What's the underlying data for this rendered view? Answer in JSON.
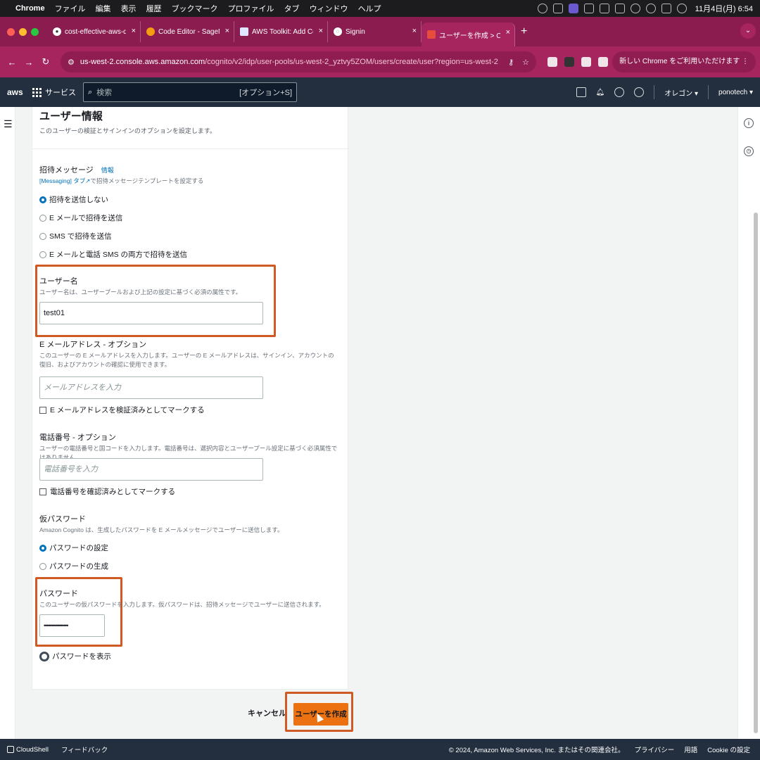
{
  "mac_menu": {
    "app": "Chrome",
    "items": [
      "ファイル",
      "編集",
      "表示",
      "履歴",
      "ブックマーク",
      "プロファイル",
      "タブ",
      "ウィンドウ",
      "ヘルプ"
    ],
    "clock": "11月4日(月) 6:54"
  },
  "tabs": [
    {
      "title": "cost-effective-aws-deployme",
      "icon": "github-icon"
    },
    {
      "title": "Code Editor - SageMaker Stu",
      "icon": "sagemaker-icon"
    },
    {
      "title": "AWS Toolkit: Add Connection",
      "icon": "document-icon"
    },
    {
      "title": "Signin",
      "icon": "globe-icon"
    },
    {
      "title": "ユーザーを作成 > ComfyUIuse",
      "icon": "cognito-icon"
    }
  ],
  "address": {
    "host": "us-west-2.console.aws.amazon.com",
    "path": "/cognito/v2/idp/user-pools/us-west-2_yztvy5ZOM/users/create/user?region=us-west-2",
    "update_label": "新しい Chrome をご利用いただけます"
  },
  "awsnav": {
    "logo": "aws",
    "services": "サービス",
    "search_placeholder": "検索",
    "search_shortcut": "[オプション+S]",
    "region": "オレゴン ▾",
    "account": "ponotech ▾"
  },
  "panel": {
    "title": "ユーザー情報",
    "description": "このユーザーの検証とサインインのオプションを設定します。"
  },
  "invite": {
    "label": "招待メッセージ",
    "info": "情報",
    "link_tab": "[Messaging] タブ",
    "link_suffix": "で招待メッセージテンプレートを設定する",
    "options": [
      "招待を送信しない",
      "E メールで招待を送信",
      "SMS で招待を送信",
      "E メールと電話 SMS の両方で招待を送信"
    ]
  },
  "username": {
    "label": "ユーザー名",
    "description": "ユーザー名は、ユーザープールおよび上記の設定に基づく必須の属性です。",
    "value": "test01"
  },
  "email": {
    "label": "E メールアドレス - オプション",
    "description": "このユーザーの E メールアドレスを入力します。ユーザーの E メールアドレスは、サインイン、アカウントの復旧、およびアカウントの確認に使用できます。",
    "placeholder": "メールアドレスを入力",
    "verify": "E メールアドレスを検証済みとしてマークする"
  },
  "phone": {
    "label": "電話番号 - オプション",
    "description": "ユーザーの電話番号と国コードを入力します。電話番号は、選択内容とユーザープール設定に基づく必須属性ではありません。",
    "placeholder": "電話番号を入力",
    "verify": "電話番号を確認済みとしてマークする"
  },
  "temp_password": {
    "label": "仮パスワード",
    "description": "Amazon Cognito は、生成したパスワードを E メールメッセージでユーザーに送信します。",
    "options": [
      "パスワードの設定",
      "パスワードの生成"
    ]
  },
  "password": {
    "label": "パスワード",
    "description": "このユーザーの仮パスワードを入力します。仮パスワードは、招待メッセージでユーザーに送信されます。",
    "value": "••••••••••••••••",
    "show": "パスワードを表示"
  },
  "actions": {
    "cancel": "キャンセル",
    "create": "ユーザーを作成"
  },
  "footer": {
    "cloudshell": "CloudShell",
    "feedback": "フィードバック",
    "copyright": "© 2024, Amazon Web Services, Inc. またはその関連会社。",
    "privacy": "プライバシー",
    "terms": "用語",
    "cookie": "Cookie の設定"
  },
  "colors": {
    "accent": "#ec7211",
    "highlight": "#d05a24",
    "link": "#0073bb",
    "browser_frame": "#a6255f",
    "aws_nav": "#232f3e"
  }
}
